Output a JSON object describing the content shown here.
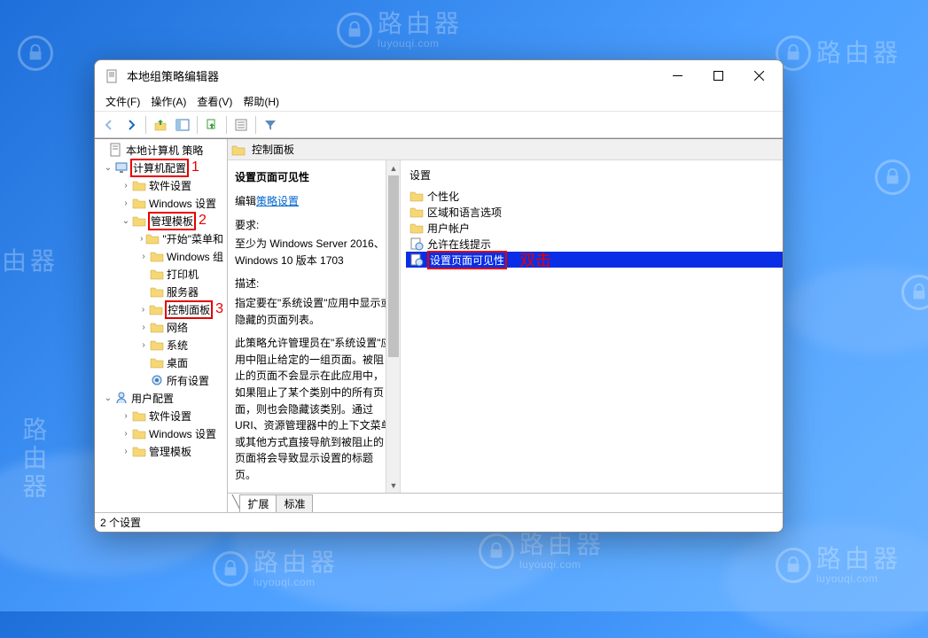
{
  "watermark": {
    "brand": "路由器",
    "domain": "luyouqi.com"
  },
  "window": {
    "title": "本地组策略编辑器"
  },
  "menu": {
    "file": "文件(F)",
    "action": "操作(A)",
    "view": "查看(V)",
    "help": "帮助(H)"
  },
  "tree": {
    "root": "本地计算机 策略",
    "computer_config": "计算机配置",
    "num1": "1",
    "software_settings": "软件设置",
    "windows_settings": "Windows 设置",
    "admin_templates": "管理模板",
    "num2": "2",
    "start_menu_and": "\"开始\"菜单和",
    "windows_comp": "Windows 组",
    "printers": "打印机",
    "server": "服务器",
    "control_panel": "控制面板",
    "num3": "3",
    "network": "网络",
    "system": "系统",
    "desktop": "桌面",
    "all_settings": "所有设置",
    "user_config": "用户配置",
    "u_software_settings": "软件设置",
    "u_windows_settings": "Windows 设置",
    "u_admin_templates": "管理模板"
  },
  "crumb": {
    "label": "控制面板"
  },
  "description": {
    "title": "设置页面可见性",
    "edit_prefix": "编辑",
    "edit_link": "策略设置",
    "req_label": "要求:",
    "req_text": "至少为 Windows Server 2016、Windows 10 版本 1703",
    "desc_label": "描述:",
    "desc_p1": "指定要在\"系统设置\"应用中显示或隐藏的页面列表。",
    "desc_p2": "此策略允许管理员在\"系统设置\"应用中阻止给定的一组页面。被阻止的页面不会显示在此应用中，如果阻止了某个类别中的所有页面，则也会隐藏该类别。通过 URI、资源管理器中的上下文菜单或其他方式直接导航到被阻止的页面将会导致显示设置的标题页。"
  },
  "settings": {
    "header": "设置",
    "items": {
      "personalization": "个性化",
      "region_lang": "区域和语言选项",
      "user_accounts": "用户帐户",
      "allow_online": "允许在线提示",
      "page_visibility": "设置页面可见性"
    },
    "dblclick": "双击"
  },
  "tabs": {
    "extended": "扩展",
    "standard": "标准"
  },
  "status": "2 个设置"
}
